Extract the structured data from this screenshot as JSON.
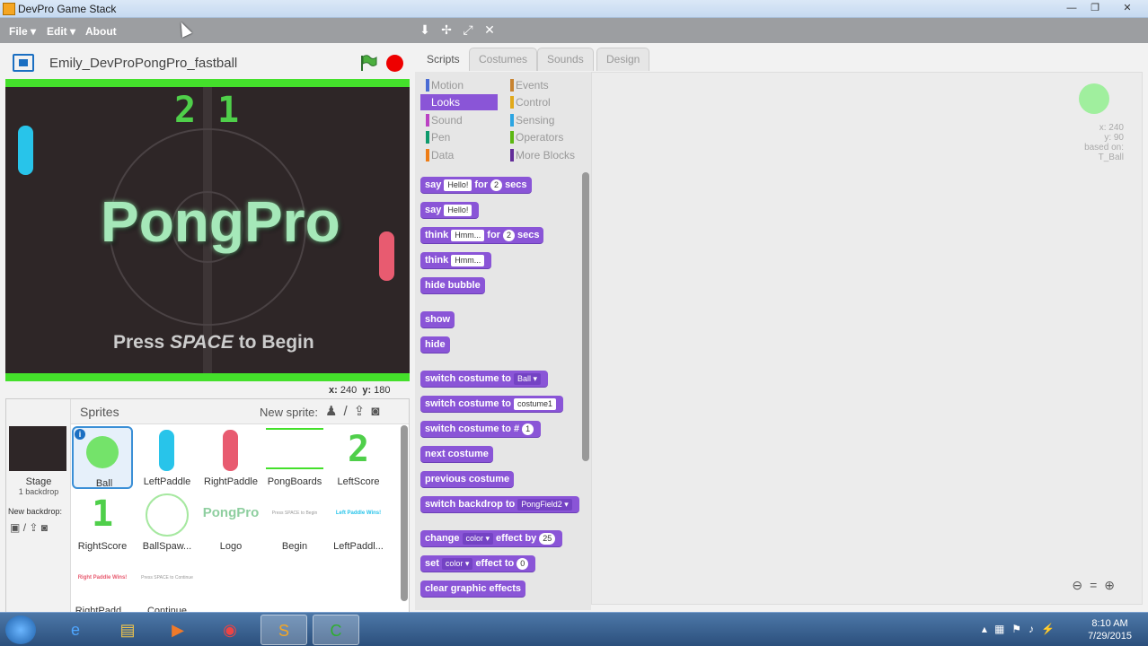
{
  "window": {
    "title": "DevPro Game Stack",
    "controls": [
      "—",
      "❐",
      "✕"
    ]
  },
  "menu": {
    "file": "File ▾",
    "edit": "Edit ▾",
    "about": "About"
  },
  "project": {
    "name": "Emily_DevProPongPro_fastball"
  },
  "stage": {
    "score_left": "2",
    "score_right": "1",
    "logo": "PongPro",
    "press_pre": "Press ",
    "press_key": "SPACE",
    "press_post": " to Begin",
    "x_label": "x:",
    "x": "240",
    "y_label": "y:",
    "y": "180"
  },
  "sprites_panel": {
    "title": "Sprites",
    "new_sprite": "New sprite:",
    "stage_label": "Stage",
    "stage_backdrops": "1 backdrop",
    "new_backdrop": "New backdrop:",
    "sprites": [
      {
        "name": "Ball",
        "kind": "ball",
        "selected": true
      },
      {
        "name": "LeftPaddle",
        "kind": "paddle-blue"
      },
      {
        "name": "RightPaddle",
        "kind": "paddle-red"
      },
      {
        "name": "PongBoards",
        "kind": "boards"
      },
      {
        "name": "LeftScore",
        "kind": "score-2"
      },
      {
        "name": "RightScore",
        "kind": "score-1"
      },
      {
        "name": "BallSpaw...",
        "kind": "ring"
      },
      {
        "name": "Logo",
        "kind": "logo",
        "art": "PongPro"
      },
      {
        "name": "Begin",
        "kind": "text-small",
        "art": "Press SPACE to Begin"
      },
      {
        "name": "LeftPaddl...",
        "kind": "text-small-blue",
        "art": "Left Paddle Wins!"
      },
      {
        "name": "RightPadd...",
        "kind": "text-small-red",
        "art": "Right Paddle Wins!"
      },
      {
        "name": "Continue",
        "kind": "text-small",
        "art": "Press SPACE to Continue"
      }
    ]
  },
  "tabs": [
    "Scripts",
    "Costumes",
    "Sounds",
    "Design"
  ],
  "categories": [
    {
      "name": "Motion",
      "color": "#4a6cd4"
    },
    {
      "name": "Events",
      "color": "#c88330"
    },
    {
      "name": "Looks",
      "color": "#8a55d7",
      "active": true
    },
    {
      "name": "Control",
      "color": "#e1a91a"
    },
    {
      "name": "Sound",
      "color": "#bb42c3"
    },
    {
      "name": "Sensing",
      "color": "#2ca5e2"
    },
    {
      "name": "Pen",
      "color": "#0e9a6c"
    },
    {
      "name": "Operators",
      "color": "#5cb712"
    },
    {
      "name": "Data",
      "color": "#ee7d16"
    },
    {
      "name": "More Blocks",
      "color": "#632d99"
    }
  ],
  "blocks": {
    "say_for": {
      "a": "say",
      "arg": "Hello!",
      "b": "for",
      "num": "2",
      "c": "secs"
    },
    "say": {
      "a": "say",
      "arg": "Hello!"
    },
    "think_for": {
      "a": "think",
      "arg": "Hmm...",
      "b": "for",
      "num": "2",
      "c": "secs"
    },
    "think": {
      "a": "think",
      "arg": "Hmm..."
    },
    "hide_bubble": "hide bubble",
    "show": "show",
    "hide": "hide",
    "switch_costume_drop": {
      "a": "switch costume to",
      "drop": "Ball ▾"
    },
    "switch_costume_arg": {
      "a": "switch costume to",
      "arg": "costume1"
    },
    "switch_costume_num": {
      "a": "switch costume to #",
      "num": "1"
    },
    "next_costume": "next costume",
    "previous_costume": "previous costume",
    "switch_backdrop": {
      "a": "switch backdrop to",
      "drop": "PongField2 ▾"
    },
    "change_effect": {
      "a": "change",
      "drop": "color ▾",
      "b": "effect by",
      "num": "25"
    },
    "set_effect": {
      "a": "set",
      "drop": "color ▾",
      "b": "effect to",
      "num": "0"
    },
    "clear_effects": "clear graphic effects"
  },
  "sprite_info": {
    "x": "x: 240",
    "y": "y: 90",
    "based_on": "based on:",
    "based_name": "T_Ball"
  },
  "taskbar": {
    "time": "8:10 AM",
    "date": "7/29/2015"
  }
}
